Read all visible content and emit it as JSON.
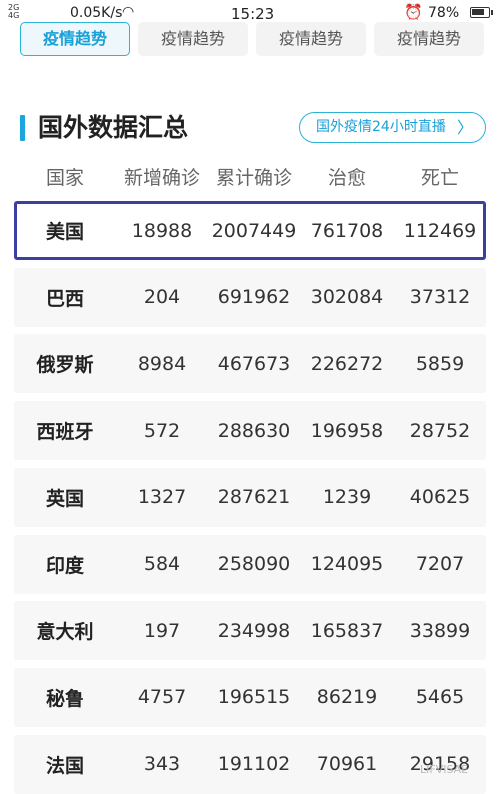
{
  "status_bar": {
    "signal_top": "2G",
    "signal_bottom": "4G",
    "network_speed": "0.05K/s",
    "time": "15:23",
    "battery_level": 0.78,
    "battery_text": "78%"
  },
  "tabs": [
    {
      "label": "疫情趋势",
      "active": true
    },
    {
      "label": "疫情趋势",
      "active": false
    },
    {
      "label": "疫情趋势",
      "active": false
    },
    {
      "label": "疫情趋势",
      "active": false
    }
  ],
  "section": {
    "title": "国外数据汇总",
    "live_button_label": "国外疫情24小时直播"
  },
  "table": {
    "headers": [
      "国家",
      "新增确诊",
      "累计确诊",
      "治愈",
      "死亡"
    ],
    "rows": [
      {
        "country": "美国",
        "new": "18988",
        "total": "2007449",
        "cured": "761708",
        "dead": "112469",
        "highlight": true
      },
      {
        "country": "巴西",
        "new": "204",
        "total": "691962",
        "cured": "302084",
        "dead": "37312"
      },
      {
        "country": "俄罗斯",
        "new": "8984",
        "total": "467673",
        "cured": "226272",
        "dead": "5859"
      },
      {
        "country": "西班牙",
        "new": "572",
        "total": "288630",
        "cured": "196958",
        "dead": "28752"
      },
      {
        "country": "英国",
        "new": "1327",
        "total": "287621",
        "cured": "1239",
        "dead": "40625"
      },
      {
        "country": "印度",
        "new": "584",
        "total": "258090",
        "cured": "124095",
        "dead": "7207"
      },
      {
        "country": "意大利",
        "new": "197",
        "total": "234998",
        "cured": "165837",
        "dead": "33899"
      },
      {
        "country": "秘鲁",
        "new": "4757",
        "total": "196515",
        "cured": "86219",
        "dead": "5465"
      },
      {
        "country": "法国",
        "new": "343",
        "total": "191102",
        "cured": "70961",
        "dead": "29158"
      }
    ]
  },
  "watermark": "LIFVISAE"
}
